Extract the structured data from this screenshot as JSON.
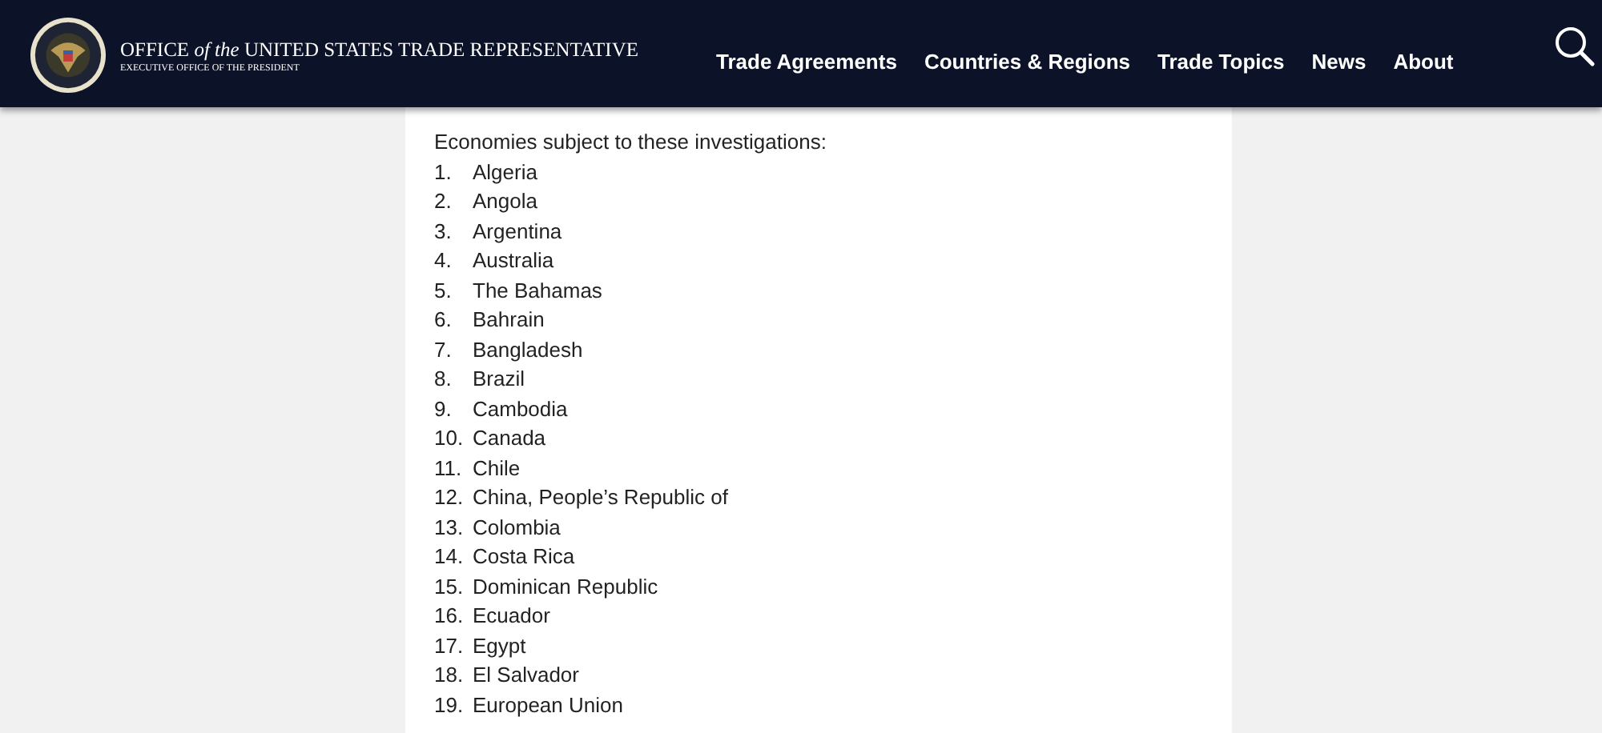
{
  "header": {
    "title": "OFFICE *of the* UNITED STATES TRADE REPRESENTATIVE",
    "subtitle": "EXECUTIVE OFFICE OF THE PRESIDENT",
    "nav": [
      "Trade Agreements",
      "Countries & Regions",
      "Trade Topics",
      "News",
      "About"
    ]
  },
  "content": {
    "intro": "Economies subject to these investigations:",
    "items": [
      {
        "number": "1.",
        "name": "Algeria"
      },
      {
        "number": "2.",
        "name": "Angola"
      },
      {
        "number": "3.",
        "name": "Argentina"
      },
      {
        "number": "4.",
        "name": "Australia"
      },
      {
        "number": "5.",
        "name": "The Bahamas"
      },
      {
        "number": "6.",
        "name": "Bahrain"
      },
      {
        "number": "7.",
        "name": "Bangladesh"
      },
      {
        "number": "8.",
        "name": "Brazil"
      },
      {
        "number": "9.",
        "name": "Cambodia"
      },
      {
        "number": "10.",
        "name": "Canada"
      },
      {
        "number": "11.",
        "name": "Chile"
      },
      {
        "number": "12.",
        "name": "China, People’s Republic of"
      },
      {
        "number": "13.",
        "name": "Colombia"
      },
      {
        "number": "14.",
        "name": "Costa Rica"
      },
      {
        "number": "15.",
        "name": "Dominican Republic"
      },
      {
        "number": "16.",
        "name": "Ecuador"
      },
      {
        "number": "17.",
        "name": "Egypt"
      },
      {
        "number": "18.",
        "name": "El Salvador"
      },
      {
        "number": "19.",
        "name": "European Union"
      }
    ]
  }
}
